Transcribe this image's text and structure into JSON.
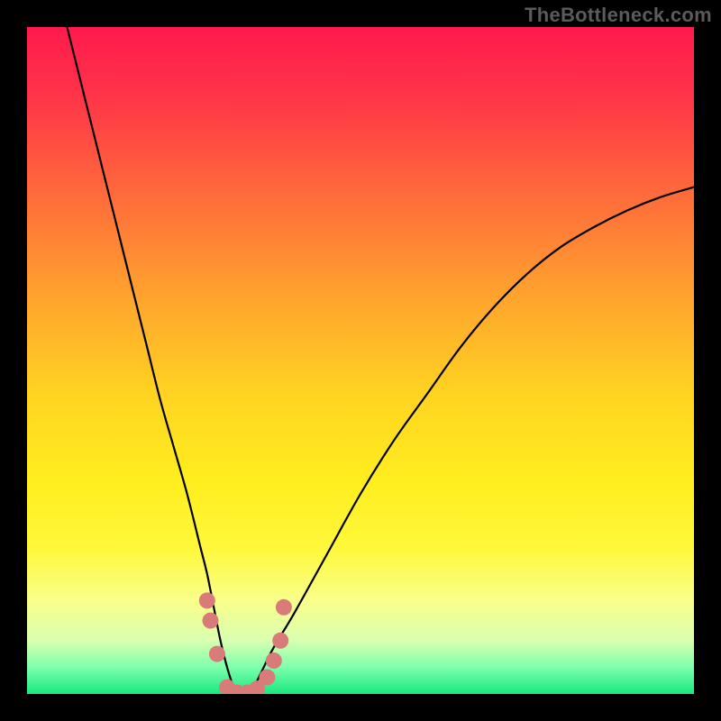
{
  "attribution": "TheBottleneck.com",
  "colors": {
    "frame": "#000000",
    "gradient_stops": [
      {
        "offset": 0.0,
        "color": "#ff1a4d"
      },
      {
        "offset": 0.1,
        "color": "#ff3348"
      },
      {
        "offset": 0.25,
        "color": "#ff6a3b"
      },
      {
        "offset": 0.4,
        "color": "#ffa22e"
      },
      {
        "offset": 0.55,
        "color": "#ffd321"
      },
      {
        "offset": 0.68,
        "color": "#ffee1f"
      },
      {
        "offset": 0.78,
        "color": "#fff83a"
      },
      {
        "offset": 0.86,
        "color": "#f9ff8a"
      },
      {
        "offset": 0.92,
        "color": "#d9ffb0"
      },
      {
        "offset": 0.96,
        "color": "#7dffad"
      },
      {
        "offset": 1.0,
        "color": "#17e880"
      }
    ],
    "curve": "#000000",
    "marker": "#d97b78"
  },
  "chart_data": {
    "type": "line",
    "title": "",
    "xlabel": "",
    "ylabel": "",
    "xlim": [
      0,
      100
    ],
    "ylim": [
      0,
      100
    ],
    "series": [
      {
        "name": "bottleneck-curve",
        "x": [
          6,
          8,
          10,
          12,
          14,
          16,
          18,
          20,
          22,
          24,
          26,
          27,
          28,
          29,
          30,
          31,
          32,
          33,
          34,
          35,
          37,
          40,
          45,
          50,
          55,
          60,
          65,
          70,
          75,
          80,
          85,
          90,
          95,
          100
        ],
        "y": [
          100,
          92,
          84,
          76,
          68,
          60,
          52,
          44,
          37,
          30,
          22,
          18,
          13,
          8,
          4,
          1,
          0,
          0,
          1,
          3,
          7,
          12,
          21,
          30,
          38,
          45,
          52,
          58,
          63,
          67,
          70,
          72.5,
          74.5,
          76
        ]
      }
    ],
    "markers": {
      "name": "lower-cluster",
      "points": [
        {
          "x": 27.0,
          "y": 14.0
        },
        {
          "x": 27.5,
          "y": 11.0
        },
        {
          "x": 28.5,
          "y": 6.0
        },
        {
          "x": 30.0,
          "y": 1.0
        },
        {
          "x": 31.5,
          "y": 0.2
        },
        {
          "x": 33.0,
          "y": 0.2
        },
        {
          "x": 34.5,
          "y": 0.8
        },
        {
          "x": 36.0,
          "y": 2.5
        },
        {
          "x": 37.0,
          "y": 5.0
        },
        {
          "x": 38.0,
          "y": 8.0
        },
        {
          "x": 38.5,
          "y": 13.0
        }
      ]
    }
  }
}
